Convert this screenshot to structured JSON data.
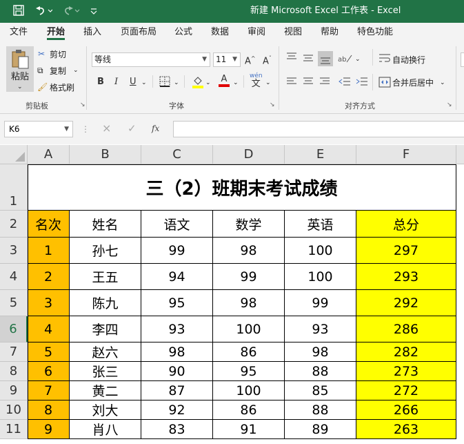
{
  "window": {
    "title": "新建 Microsoft Excel 工作表  -  Excel"
  },
  "quick_access": {
    "save_icon": "save-icon",
    "undo_icon": "undo-icon",
    "redo_icon": "redo-icon",
    "customize_icon": "customize-qat-icon"
  },
  "menu_tabs": [
    "文件",
    "开始",
    "插入",
    "页面布局",
    "公式",
    "数据",
    "审阅",
    "视图",
    "帮助",
    "特色功能"
  ],
  "active_tab": "开始",
  "ribbon": {
    "clipboard": {
      "paste_label": "粘贴",
      "cut_label": "剪切",
      "copy_label": "复制",
      "format_painter_label": "格式刷",
      "group_label": "剪贴板"
    },
    "font": {
      "font_name": "等线",
      "font_size": "11",
      "group_label": "字体",
      "bold": "B",
      "italic": "I",
      "underline": "U",
      "grow": "A",
      "shrink": "A",
      "phonetic": "wén",
      "font_color": "A"
    },
    "alignment": {
      "wrap_label": "自动换行",
      "merge_label": "合并后居中",
      "group_label": "对齐方式"
    }
  },
  "formula_bar": {
    "name_box": "K6",
    "fx": "fx",
    "cancel": "×",
    "enter": "✓",
    "value": ""
  },
  "sheet": {
    "columns": [
      "A",
      "B",
      "C",
      "D",
      "E",
      "F"
    ],
    "rows": [
      "1",
      "2",
      "3",
      "4",
      "5",
      "6",
      "7",
      "8",
      "9",
      "10",
      "11"
    ],
    "selected_row": "6",
    "title": "三（2）班期末考试成绩",
    "headers": [
      "名次",
      "姓名",
      "语文",
      "数学",
      "英语",
      "总分"
    ],
    "data": [
      [
        "1",
        "孙七",
        "99",
        "98",
        "100",
        "297"
      ],
      [
        "2",
        "王五",
        "94",
        "99",
        "100",
        "293"
      ],
      [
        "3",
        "陈九",
        "95",
        "98",
        "99",
        "292"
      ],
      [
        "4",
        "李四",
        "93",
        "100",
        "93",
        "286"
      ],
      [
        "5",
        "赵六",
        "98",
        "86",
        "98",
        "282"
      ],
      [
        "6",
        "张三",
        "90",
        "95",
        "88",
        "273"
      ],
      [
        "7",
        "黄二",
        "87",
        "100",
        "85",
        "272"
      ],
      [
        "8",
        "刘大",
        "92",
        "86",
        "88",
        "266"
      ],
      [
        "9",
        "肖八",
        "83",
        "91",
        "89",
        "263"
      ]
    ]
  },
  "colors": {
    "excel_green": "#217346",
    "rank_fill": "#ffc000",
    "total_fill": "#ffff00"
  }
}
